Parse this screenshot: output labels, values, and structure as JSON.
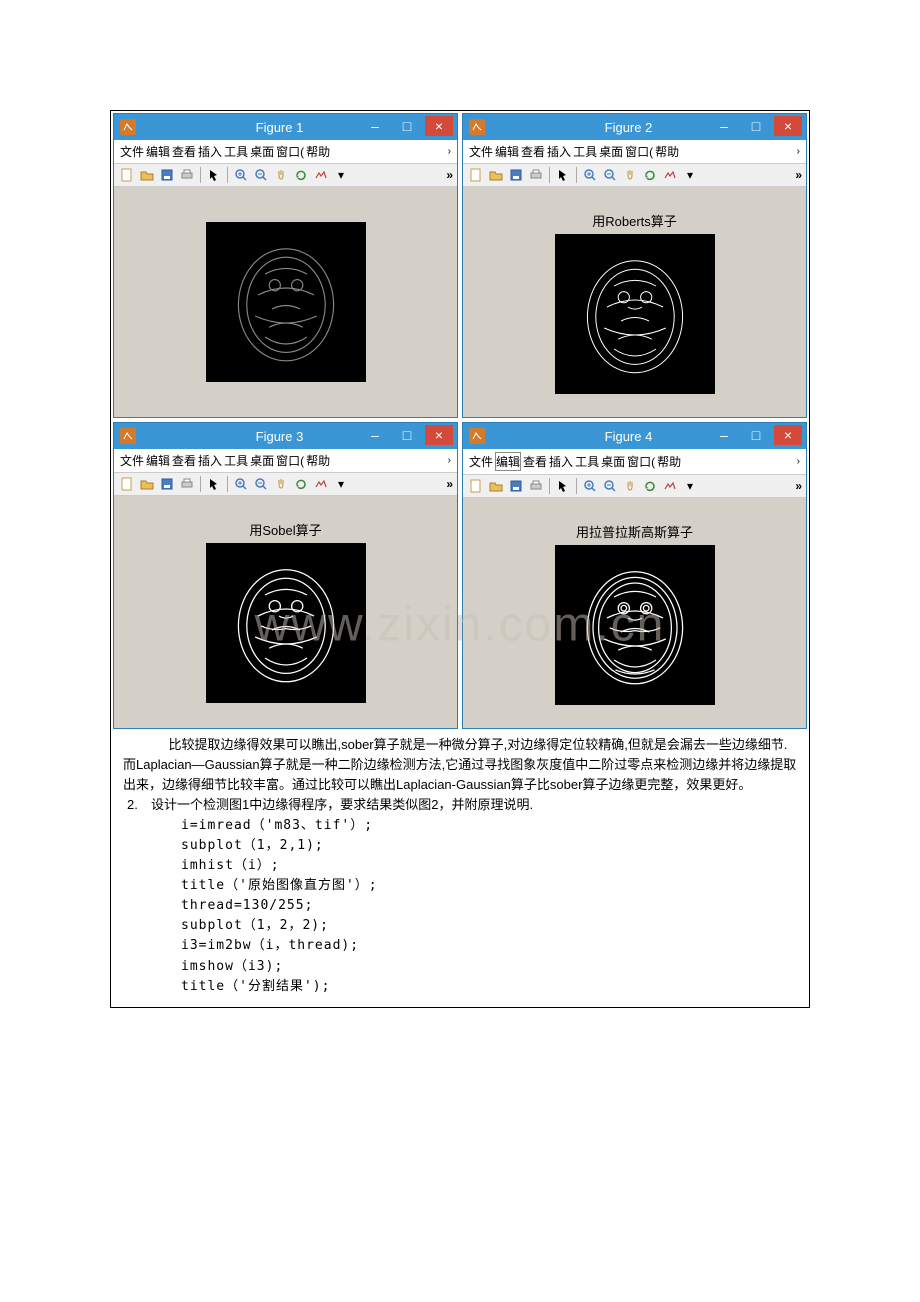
{
  "watermark": "www.zixin.com.cn",
  "figures": [
    {
      "title": "Figure 1",
      "caption": "",
      "img": "gray"
    },
    {
      "title": "Figure 2",
      "caption": "用Roberts算子",
      "img": "edge"
    },
    {
      "title": "Figure 3",
      "caption": "用Sobel算子",
      "img": "edge"
    },
    {
      "title": "Figure 4",
      "caption": "用拉普拉斯高斯算子",
      "img": "edge"
    }
  ],
  "menus": {
    "file": "文件",
    "edit": "编辑",
    "view": "查看",
    "insert": "插入",
    "tool": "工具",
    "desk": "桌面",
    "win": "窗口(",
    "help": "帮助",
    "more": "›"
  },
  "titlebar": {
    "min": "–",
    "max": "□",
    "close": "×"
  },
  "toolbar": {
    "more": "»"
  },
  "body": {
    "p1": "比较提取边缘得效果可以瞧出,sober算子就是一种微分算子,对边缘得定位较精确,但就是会漏去一些边缘细节.而Laplacian—Gaussian算子就是一种二阶边缘检测方法,它通过寻找图象灰度值中二阶过零点来检测边缘并将边缘提取出来，边缘得细节比较丰富。通过比较可以瞧出Laplacian-Gaussian算子比sober算子边缘更完整，效果更好。",
    "q2_num": "2.",
    "q2_text": "设计一个检测图1中边缘得程序，要求结果类似图2，并附原理说明.",
    "code": [
      "i=imread（'m83、tif'）;",
      "subplot（1，2,1);",
      "imhist（i）;",
      "title（'原始图像直方图'）;",
      "thread=130/255;",
      "subplot（1，2，2);",
      "i3=im2bw（i，thread);",
      "imshow（i3);",
      "title（'分割结果');"
    ]
  }
}
